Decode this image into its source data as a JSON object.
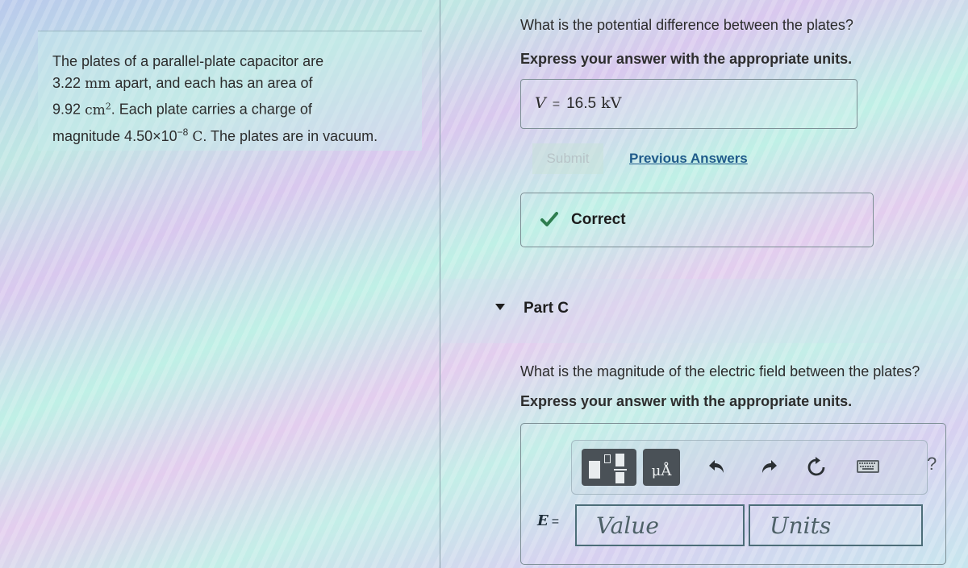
{
  "problem": {
    "line1": "The plates of a parallel-plate capacitor are",
    "line2_value": "3.22",
    "line2_unit": "mm",
    "line2_rest": " apart, and each has an area of",
    "line3_value": "9.92",
    "line3_unit": "cm",
    "line3_exp": "2",
    "line3_rest": ". Each plate carries a charge of",
    "line4_prefix": "magnitude 4.50×10",
    "line4_exp": "−8",
    "line4_unit": "C",
    "line4_rest": ". The plates are in vacuum."
  },
  "part_b": {
    "question": "What is the potential difference between the plates?",
    "instruction": "Express your answer with the appropriate units.",
    "answer": {
      "variable": "V",
      "equals": "=",
      "value": "16.5",
      "unit": "kV"
    },
    "submit_label": "Submit",
    "previous_answers_label": "Previous Answers",
    "feedback": {
      "status": "Correct",
      "icon": "check-icon",
      "color": "#2e7d4f"
    }
  },
  "part_c": {
    "title": "Part C",
    "question": "What is the magnitude of the electric field between the plates?",
    "instruction": "Express your answer with the appropriate units.",
    "toolbar": {
      "templates_icon": "templates-icon",
      "units_label": "μÅ",
      "undo_icon": "undo-icon",
      "redo_icon": "redo-icon",
      "reset_icon": "reset-icon",
      "keyboard_icon": "keyboard-icon",
      "help_label": "?"
    },
    "variable": "E",
    "equals": "=",
    "value_placeholder": "Value",
    "units_placeholder": "Units"
  }
}
